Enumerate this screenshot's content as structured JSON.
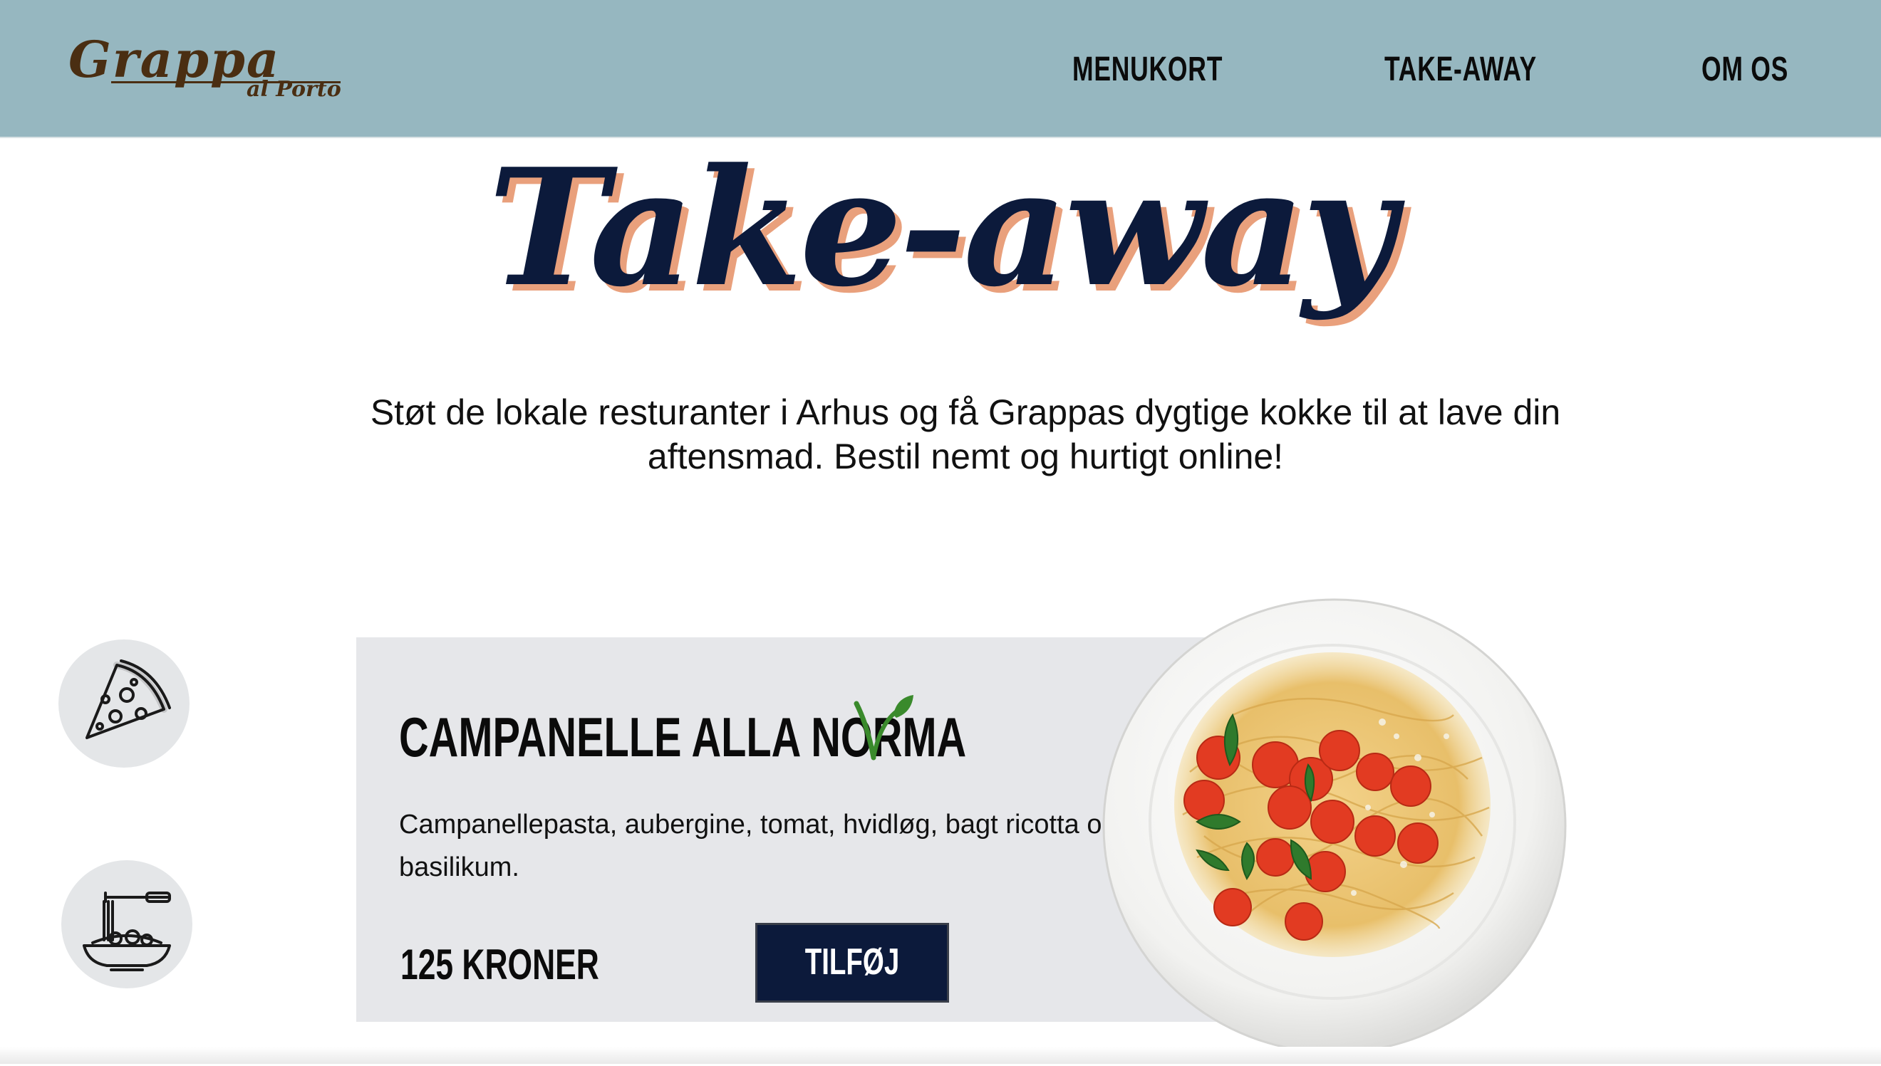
{
  "header": {
    "logo": {
      "name": "Grappa",
      "sub": "al Porto"
    },
    "nav": [
      {
        "label": "MENUKORT"
      },
      {
        "label": "TAKE-AWAY"
      },
      {
        "label": "OM OS"
      }
    ]
  },
  "hero": {
    "title": "Take-away",
    "intro": "Støt de lokale resturanter i Arhus og få Grappas dygtige kokke til at lave din aftensmad. Bestil nemt og hurtigt online!"
  },
  "categories": [
    {
      "icon": "pizza-slice-icon"
    },
    {
      "icon": "pasta-bowl-icon"
    }
  ],
  "product": {
    "name": "CAMPANELLE ALLA NORMA",
    "badge_icon": "vegetarian-leaf-icon",
    "description": "Campanellepasta, aubergine, tomat, hvidløg, bagt ricotta og basilikum.",
    "price": "125 KRONER",
    "add_label": "TILFØJ",
    "image_icon": "pasta-dish-image"
  },
  "colors": {
    "header_bg": "#96b7c0",
    "logo": "#4a2e12",
    "title": "#0c1a3b",
    "title_shadow": "#e9a07c",
    "card_bg": "#e6e7ea",
    "button_bg": "#0c1a3b",
    "veg_green": "#3a8a2c"
  }
}
